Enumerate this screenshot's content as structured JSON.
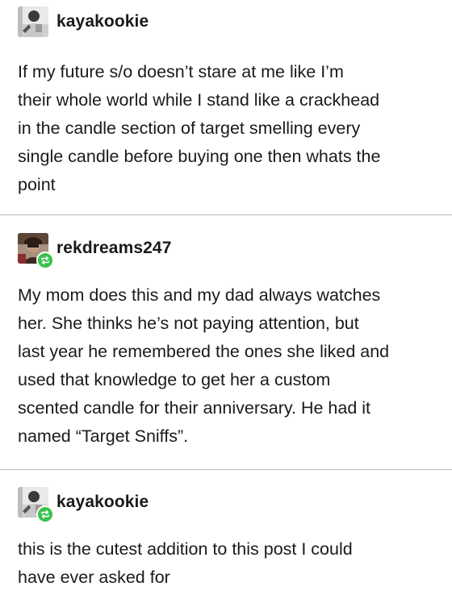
{
  "posts": [
    {
      "username": "kayakookie",
      "reblog": false,
      "avatar_icon": "user-photo-icon",
      "lines": [
        "If my future s/o doesn’t stare at me like I’m",
        "their whole world while I stand like a crackhead",
        "in the candle section of target smelling every",
        "single candle before buying one then whats the",
        "point"
      ]
    },
    {
      "username": "rekdreams247",
      "reblog": true,
      "avatar_icon": "user-photo-icon",
      "lines": [
        "My mom does this and my dad always watches",
        "her. She thinks he’s not paying attention, but",
        "last year he remembered the ones she liked and",
        "used that knowledge to get her a custom",
        "scented candle for their anniversary. He had it",
        "named “Target Sniffs”."
      ]
    },
    {
      "username": "kayakookie",
      "reblog": true,
      "avatar_icon": "user-photo-icon",
      "lines": [
        "this is the cutest addition to this post I could",
        "have ever asked for"
      ]
    }
  ],
  "colors": {
    "text": "#1a1a1a",
    "divider": "#b8b8b8",
    "reblog_badge": "#37c24a"
  }
}
